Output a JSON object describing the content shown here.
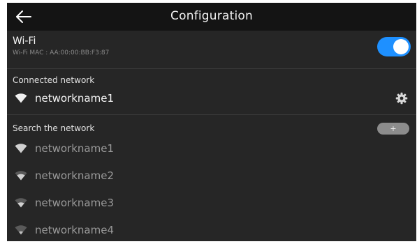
{
  "header": {
    "back_icon": "arrow-left-icon",
    "title": "Configuration"
  },
  "wifi": {
    "title": "Wi-Fi",
    "mac": "Wi-Fi MAC : AA:00:00:BB:F3:87",
    "enabled": true,
    "toggle_color": "#1e90ff"
  },
  "connected": {
    "label": "Connected network",
    "network": {
      "name": "networkname1",
      "icon": "wifi-icon",
      "settings_icon": "gear-icon"
    }
  },
  "search": {
    "label": "Search the network",
    "add_label": "+",
    "networks": [
      {
        "name": "networkname1",
        "icon": "wifi-icon"
      },
      {
        "name": "networkname2",
        "icon": "wifi-icon"
      },
      {
        "name": "networkname3",
        "icon": "wifi-icon"
      },
      {
        "name": "networkname4",
        "icon": "wifi-icon"
      }
    ]
  },
  "colors": {
    "background": "#262626",
    "header": "#141414",
    "accent": "#1e90ff"
  }
}
